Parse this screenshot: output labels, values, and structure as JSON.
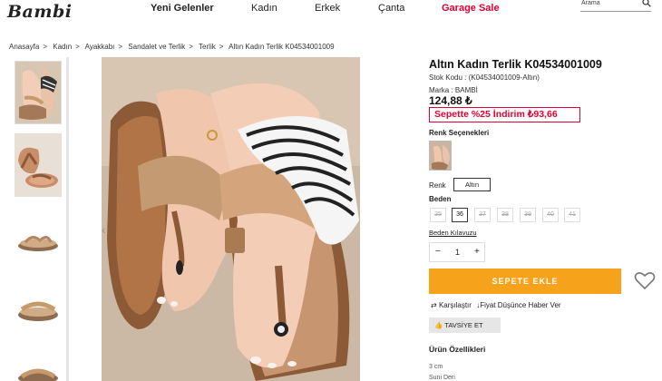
{
  "header": {
    "logo": "Bambi",
    "nav": [
      "Yeni Gelenler",
      "Kadın",
      "Erkek",
      "Çanta",
      "Garage Sale"
    ],
    "search_placeholder": "Arama"
  },
  "breadcrumb": [
    "Anasayfa",
    "Kadın",
    "Ayakkabı",
    "Sandalet ve Terlik",
    "Terlik",
    "Altın Kadın Terlik K04534001009"
  ],
  "breadcrumb_sep": ">",
  "product": {
    "title": "Altın Kadın Terlik K04534001009",
    "sku": "Stok Kodu : (K04534001009-Altın)",
    "brand": "Marka : BAMBİ",
    "price": "124,88 ₺",
    "promo": "Sepette %25 İndirim ₺93,66",
    "color_options_label": "Renk Seçenekleri",
    "color_label": "Renk",
    "color_value": "Altın",
    "size_label": "Beden",
    "sizes": [
      "35",
      "36",
      "37",
      "38",
      "39",
      "40",
      "41"
    ],
    "selected_size": "36",
    "size_guide": "Beden Kılavuzu",
    "quantity": "1",
    "qty_minus": "−",
    "qty_plus": "+",
    "add_to_cart": "SEPETE EKLE",
    "compare": "Karşılaştır",
    "price_alert": "Fiyat Düşünce Haber Ver",
    "recommend": "TAVSİYE ET",
    "features_title": "Ürün Özellikleri",
    "features": [
      "3 cm",
      "Suni Deri"
    ]
  },
  "colors": {
    "accent_red": "#e00034",
    "cart_orange": "#f6a21a"
  }
}
